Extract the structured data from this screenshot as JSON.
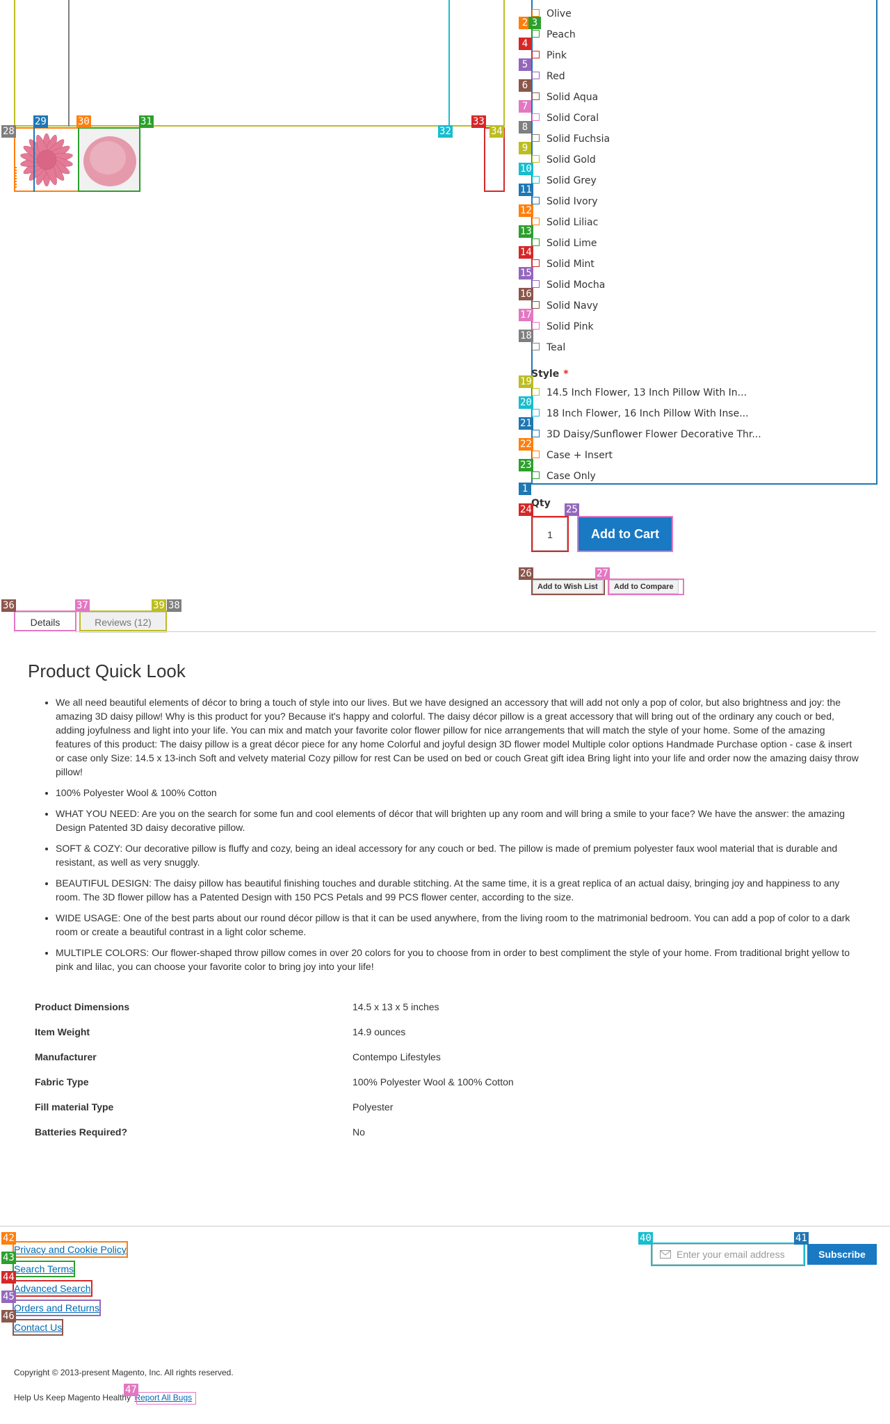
{
  "colors": {
    "primary_button": "#1979c3",
    "link": "#006bb4",
    "required_star": "#e02b27",
    "flower_pink": "#e07a96"
  },
  "options": {
    "color_items": [
      "Olive",
      "Peach",
      "Pink",
      "Red",
      "Solid Aqua",
      "Solid Coral",
      "Solid Fuchsia",
      "Solid Gold",
      "Solid Grey",
      "Solid Ivory",
      "Solid Liliac",
      "Solid Lime",
      "Solid Mint",
      "Solid Mocha",
      "Solid Navy",
      "Solid Pink",
      "Teal"
    ],
    "style_title": "Style",
    "required_mark": "*",
    "style_items": [
      "14.5 Inch Flower, 13 Inch Pillow With In...",
      "18 Inch Flower, 16 Inch Pillow With Inse...",
      "3D Daisy/Sunflower Flower Decorative Thr...",
      "Case + Insert",
      "Case Only"
    ]
  },
  "cart": {
    "qty_label": "Qty",
    "qty_value": "1",
    "add_to_cart": "Add to Cart",
    "wishlist": "Add to Wish List",
    "compare": "Add to Compare"
  },
  "tabs": {
    "details": "Details",
    "reviews": "Reviews (12)"
  },
  "details": {
    "title": "Product Quick Look",
    "bullets": [
      "We all need beautiful elements of décor to bring a touch of style into our lives. But we have designed an accessory that will add not only a pop of color, but also brightness and joy: the amazing 3D daisy pillow! Why is this product for you? Because it's happy and colorful. The daisy décor pillow is a great accessory that will bring out of the ordinary any couch or bed, adding joyfulness and light into your life. You can mix and match your favorite color flower pillow for nice arrangements that will match the style of your home. Some of the amazing features of this product: The daisy pillow is a great décor piece for any home Colorful and joyful design 3D flower model Multiple color options Handmade Purchase option - case & insert or case only Size: 14.5 x 13-inch Soft and velvety material Cozy pillow for rest Can be used on bed or couch Great gift idea Bring light into your life and order now the amazing daisy throw pillow!",
      "100% Polyester Wool & 100% Cotton",
      "WHAT YOU NEED: Are you on the search for some fun and cool elements of décor that will brighten up any room and will bring a smile to your face? We have the answer: the amazing Design Patented 3D daisy decorative pillow.",
      "SOFT & COZY: Our decorative pillow is fluffy and cozy, being an ideal accessory for any couch or bed. The pillow is made of premium polyester faux wool material that is durable and resistant, as well as very snuggly.",
      "BEAUTIFUL DESIGN: The daisy pillow has beautiful finishing touches and durable stitching. At the same time, it is a great replica of an actual daisy, bringing joy and happiness to any room. The 3D flower pillow has a Patented Design with 150 PCS Petals and 99 PCS flower center, according to the size.",
      "WIDE USAGE: One of the best parts about our round décor pillow is that it can be used anywhere, from the living room to the matrimonial bedroom. You can add a pop of color to a dark room or create a beautiful contrast in a light color scheme.",
      "MULTIPLE COLORS: Our flower-shaped throw pillow comes in over 20 colors for you to choose from in order to best compliment the style of your home. From traditional bright yellow to pink and lilac, you can choose your favorite color to bring joy into your life!"
    ],
    "specs": [
      {
        "k": "Product Dimensions",
        "v": "14.5 x 13 x 5 inches"
      },
      {
        "k": "Item Weight",
        "v": "14.9 ounces"
      },
      {
        "k": "Manufacturer",
        "v": "Contempo Lifestyles"
      },
      {
        "k": "Fabric Type",
        "v": "100% Polyester Wool & 100% Cotton"
      },
      {
        "k": "Fill material Type",
        "v": "Polyester"
      },
      {
        "k": "Batteries Required?",
        "v": "No"
      }
    ]
  },
  "footer": {
    "links": [
      "Privacy and Cookie Policy",
      "Search Terms",
      "Advanced Search",
      "Orders and Returns",
      "Contact Us"
    ],
    "email_placeholder": "Enter your email address",
    "subscribe": "Subscribe",
    "copyright": "Copyright © 2013-present Magento, Inc. All rights reserved.",
    "bugs_text": "Help Us Keep Magento Healthy",
    "bugs_link": "Report All Bugs"
  },
  "overlay": {
    "badge_labels": [
      "1",
      "2",
      "3",
      "4",
      "5",
      "6",
      "7",
      "8",
      "9",
      "10",
      "11",
      "12",
      "13",
      "14",
      "15",
      "16",
      "17",
      "18",
      "19",
      "20",
      "21",
      "22",
      "23",
      "24",
      "25",
      "26",
      "27",
      "28",
      "29",
      "30",
      "31",
      "32",
      "33",
      "34",
      "36",
      "37",
      "38",
      "39",
      "40",
      "41",
      "42",
      "43",
      "44",
      "45",
      "46",
      "47"
    ],
    "palette": [
      "#1f77b4",
      "#ff7f0e",
      "#2ca02c",
      "#d62728",
      "#9467bd",
      "#8c564b",
      "#e377c2",
      "#7f7f7f",
      "#bcbd22",
      "#17becf"
    ]
  }
}
